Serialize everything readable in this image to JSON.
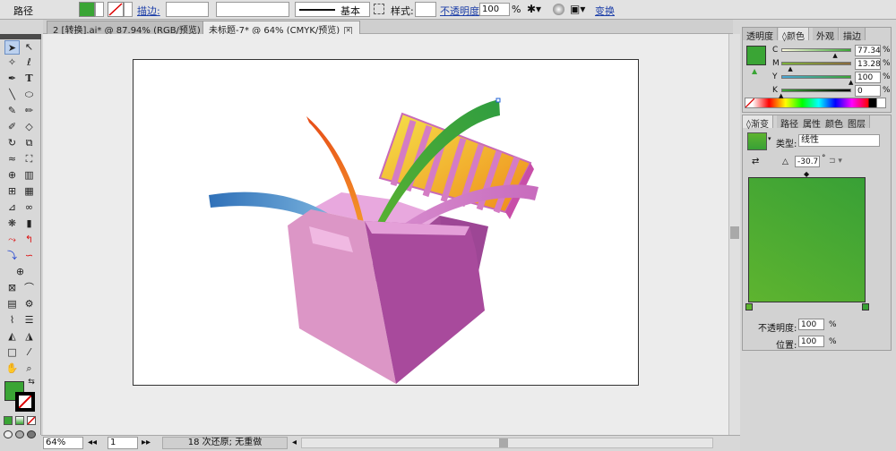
{
  "control_bar": {
    "object_type": "路径",
    "fill_color": "#3aa535",
    "stroke_label": "描边:",
    "brush_label": "基本",
    "style_label": "样式:",
    "opacity_label": "不透明度:",
    "opacity_value": "100",
    "percent": "%",
    "transform_label": "变换"
  },
  "doc_tabs": [
    {
      "label": "2 [转换].ai* @ 87.94% (RGB/预览)"
    },
    {
      "label": "未标题-7* @ 64% (CMYK/预览)"
    }
  ],
  "status_bar": {
    "zoom": "64%",
    "artboard_num": "1",
    "message": "18 次还原; 无重做"
  },
  "color_panel": {
    "tabs": [
      "透明度",
      "颜色",
      "外观",
      "描边"
    ],
    "swatch": "#3aa535",
    "channels": [
      {
        "label": "C",
        "value": "77.34",
        "level": 77.34
      },
      {
        "label": "M",
        "value": "13.28",
        "level": 13.28
      },
      {
        "label": "Y",
        "value": "100",
        "level": 100
      },
      {
        "label": "K",
        "value": "0",
        "level": 0
      }
    ]
  },
  "gradient_panel": {
    "tabs": [
      "渐变",
      "路径",
      "属性",
      "颜色",
      "图层"
    ],
    "type_label": "类型:",
    "type_value": "线性",
    "angle_value": "-30.7",
    "degree": "°",
    "opacity_label": "不透明度:",
    "opacity_value": "100",
    "location_label": "位置:",
    "location_value": "100",
    "percent": "%",
    "color_start": "#5eb42f",
    "color_end": "#38a036"
  }
}
